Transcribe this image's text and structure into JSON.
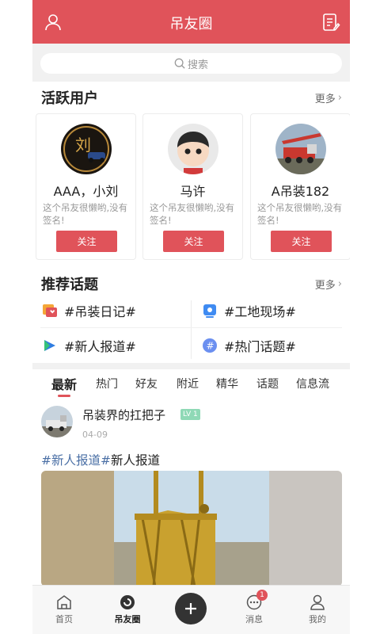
{
  "header": {
    "title": "吊友圈"
  },
  "search": {
    "placeholder": "搜索"
  },
  "active_users": {
    "title": "活跃用户",
    "more": "更多",
    "users": [
      {
        "name": "AAA，小刘",
        "bio": "这个吊友很懒哟,没有签名!",
        "follow": "关注",
        "avatar_text": "刘"
      },
      {
        "name": "马许",
        "bio": "这个吊友很懒哟,没有签名!",
        "follow": "关注"
      },
      {
        "name": "A吊装182",
        "bio": "这个吊友很懒哟,没有签名!",
        "follow": "关注"
      }
    ]
  },
  "topics": {
    "title": "推荐话题",
    "more": "更多",
    "items": [
      {
        "label": "#吊装日记#",
        "icon": "diary-icon"
      },
      {
        "label": "#工地现场#",
        "icon": "site-icon"
      },
      {
        "label": "#新人报道#",
        "icon": "newcomer-icon"
      },
      {
        "label": "#热门话题#",
        "icon": "hashtag-icon"
      }
    ]
  },
  "feed_tabs": [
    "最新",
    "热门",
    "好友",
    "附近",
    "精华",
    "话题",
    "信息流"
  ],
  "post": {
    "author": "吊装界的扛把子",
    "level": "LV 1",
    "date": "04-09",
    "tag": "#新人报道#",
    "text": "新人报道"
  },
  "bottom_nav": {
    "home": "首页",
    "circle": "吊友圈",
    "messages": "消息",
    "messages_badge": "1",
    "mine": "我的"
  },
  "colors": {
    "accent": "#e0535a",
    "tag": "#4a6fa5",
    "level": "#8fd9b6"
  }
}
